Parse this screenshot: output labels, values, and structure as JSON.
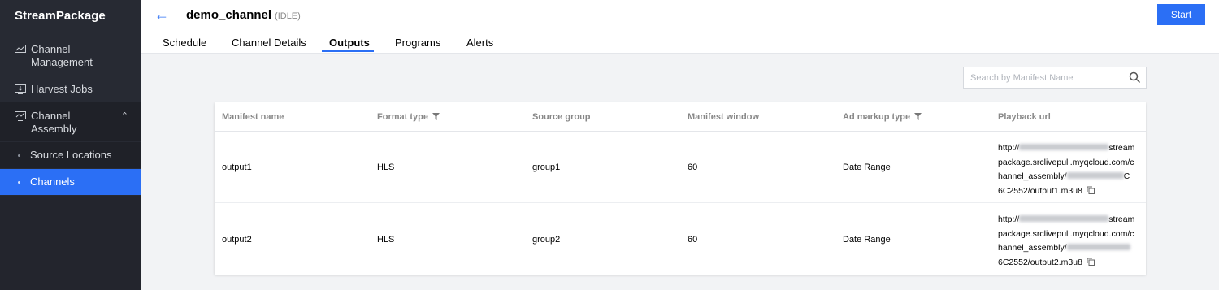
{
  "sidebar": {
    "brand": "StreamPackage",
    "items": [
      {
        "label_line1": "Channel",
        "label_line2": "Management",
        "icon": "monitor-chart-icon"
      },
      {
        "label": "Harvest Jobs",
        "icon": "download-monitor-icon"
      },
      {
        "label_line1": "Channel",
        "label_line2": "Assembly",
        "icon": "monitor-chart-icon",
        "expanded": true
      }
    ],
    "subitems": [
      {
        "label": "Source Locations",
        "active": false
      },
      {
        "label": "Channels",
        "active": true
      }
    ]
  },
  "header": {
    "title": "demo_channel",
    "status": "(IDLE)",
    "start_label": "Start",
    "tabs": [
      "Schedule",
      "Channel Details",
      "Outputs",
      "Programs",
      "Alerts"
    ],
    "active_tab": "Outputs"
  },
  "search": {
    "placeholder": "Search by Manifest Name"
  },
  "table": {
    "columns": [
      "Manifest name",
      "Format type",
      "Source group",
      "Manifest window",
      "Ad markup type",
      "Playback url"
    ],
    "rows": [
      {
        "manifest_name": "output1",
        "format_type": "HLS",
        "source_group": "group1",
        "manifest_window": "60",
        "ad_markup_type": "Date Range",
        "url_line1": "http://",
        "url_line1_tail": "stream",
        "url_line2": "package.srclivepull.myqcloud.com/c",
        "url_line3": "hannel_assembly/",
        "url_line3_tail": "C",
        "url_line4": "6C2552/output1.m3u8"
      },
      {
        "manifest_name": "output2",
        "format_type": "HLS",
        "source_group": "group2",
        "manifest_window": "60",
        "ad_markup_type": "Date Range",
        "url_line1": "http://",
        "url_line1_tail": "stream",
        "url_line2": "package.srclivepull.myqcloud.com/c",
        "url_line3": "hannel_assembly/",
        "url_line3_tail": "",
        "url_line4": "6C2552/output2.m3u8"
      }
    ]
  },
  "colors": {
    "accent": "#2b6ff5",
    "sidebar": "#272a33",
    "background": "#f2f3f5"
  }
}
